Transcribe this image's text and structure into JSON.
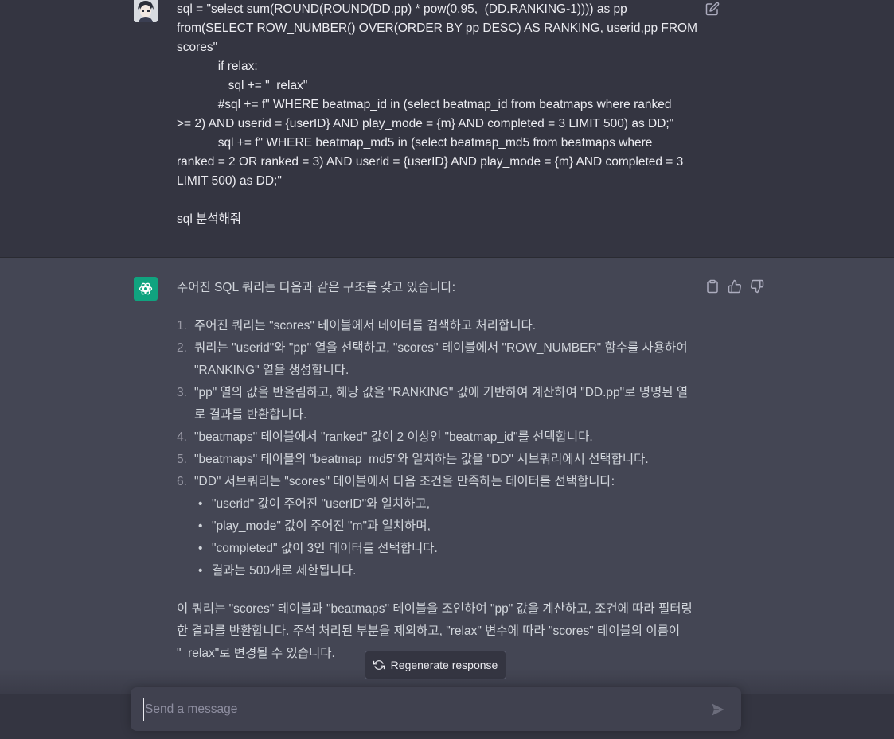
{
  "user_message": {
    "lines": [
      "sql = \"select sum(ROUND(ROUND(DD.pp) * pow(0.95,  (DD.RANKING-1)))) as pp",
      "from(SELECT ROW_NUMBER() OVER(ORDER BY pp DESC) AS RANKING, userid,pp FROM",
      "scores\"",
      "            if relax:",
      "               sql += \"_relax\"",
      "            #sql += f\" WHERE beatmap_id in (select beatmap_id from beatmaps where ranked",
      ">= 2) AND userid = {userID} AND play_mode = {m} AND completed = 3 LIMIT 500) as DD;\"",
      "            sql += f\" WHERE beatmap_md5 in (select beatmap_md5 from beatmaps where",
      "ranked = 2 OR ranked = 3) AND userid = {userID} AND play_mode = {m} AND completed = 3",
      "LIMIT 500) as DD;\"",
      "",
      "sql 분석해줘"
    ]
  },
  "assistant_message": {
    "intro": "주어진 SQL 쿼리는 다음과 같은 구조를 갖고 있습니다:",
    "steps": [
      "주어진 쿼리는 \"scores\" 테이블에서 데이터를 검색하고 처리합니다.",
      "쿼리는 \"userid\"와 \"pp\" 열을 선택하고, \"scores\" 테이블에서 \"ROW_NUMBER\" 함수를 사용하여 \"RANKING\" 열을 생성합니다.",
      "\"pp\" 열의 값을 반올림하고, 해당 값을 \"RANKING\" 값에 기반하여 계산하여 \"DD.pp\"로 명명된 열로 결과를 반환합니다.",
      "\"beatmaps\" 테이블에서 \"ranked\" 값이 2 이상인 \"beatmap_id\"를 선택합니다.",
      "\"beatmaps\" 테이블의 \"beatmap_md5\"와 일치하는 값을 \"DD\" 서브쿼리에서 선택합니다.",
      "\"DD\" 서브쿼리는 \"scores\" 테이블에서 다음 조건을 만족하는 데이터를 선택합니다:"
    ],
    "sub_items": [
      "\"userid\" 값이 주어진 \"userID\"와 일치하고,",
      "\"play_mode\" 값이 주어진 \"m\"과 일치하며,",
      "\"completed\" 값이 3인 데이터를 선택합니다.",
      "결과는 500개로 제한됩니다."
    ],
    "summary": "이 쿼리는 \"scores\" 테이블과 \"beatmaps\" 테이블을 조인하여 \"pp\" 값을 계산하고, 조건에 따라 필터링한 결과를 반환합니다. 주석 처리된 부분을 제외하고, \"relax\" 변수에 따라 \"scores\" 테이블의 이름이 \"_relax\"로 변경될 수 있습니다."
  },
  "regenerate": {
    "label": "Regenerate response"
  },
  "composer": {
    "placeholder": "Send a message",
    "value": ""
  },
  "icons": {
    "edit": "edit-icon",
    "copy": "clipboard-icon",
    "thumbs_up": "thumbs-up-icon",
    "thumbs_down": "thumbs-down-icon",
    "regenerate": "refresh-icon",
    "send": "send-icon",
    "assistant_logo": "openai-logo-icon"
  },
  "colors": {
    "background": "#343541",
    "assistant_background": "#444654",
    "assistant_logo_bg": "#10a37f",
    "input_bg": "#40414f"
  }
}
